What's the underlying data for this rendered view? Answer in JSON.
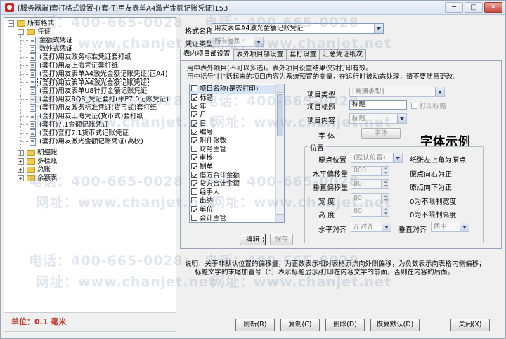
{
  "window": {
    "title": "[服务器端]套打格式设置-[(套打)用友表单A4激光金额记账凭证]153",
    "buttons": [
      "─",
      "□",
      "✕"
    ]
  },
  "tree": {
    "root": "所有格式",
    "voucher_group": "凭证",
    "items": [
      "金额式凭证",
      "数外式凭证",
      "(套打)用友政务标准凭证套打纸",
      "(套打)用友上海凭证套打纸",
      "(套打)用友表单A4激光金额记账凭证(正A4)",
      "(套打)用友表单A4激光金额记账凭证",
      "(套打)用友表单U8针打金额记账凭证",
      "(套打)用友BQ8_凭证套打(平P7.0记账凭证)",
      "(套打)用友政务标准凭证(货币式)套打纸",
      "(套打)用友上海凭证(货币式)套打纸",
      "(套打)7.1金额记账凭证",
      "(套打)套打7.1货币式记账凭证",
      "(套打)用友激光金额记账凭证(高校)"
    ],
    "selected_index": 5,
    "other_groups": [
      "明细账",
      "多栏账",
      "总账",
      "余额表"
    ]
  },
  "unit": "单位：0.1 毫米",
  "form": {
    "format_name_label": "格式名称",
    "format_name_value": "用友表单A4激光金额记账凭证",
    "voucher_type_label": "凭证类型",
    "voucher_type_value": "所有类型"
  },
  "tabs": [
    "表内项目部设置",
    "表外项目部设置",
    "套打设置",
    "汇总凭证纸次"
  ],
  "active_tab": 0,
  "notes": {
    "line1": "用中表外项目(不可以多选)。表外项目设置结果仅对打印有效。",
    "line2": "用中括号“[]”括起来的项目内容为系统预置的变量，在运行时被动态处理，请不要随意更改。"
  },
  "checklist": {
    "header": "项目名称(是否打印)",
    "items": [
      {
        "label": "标题",
        "checked": true
      },
      {
        "label": "年",
        "checked": true
      },
      {
        "label": "月",
        "checked": true
      },
      {
        "label": "日",
        "checked": true
      },
      {
        "label": "编号",
        "checked": true
      },
      {
        "label": "附件张数",
        "checked": true
      },
      {
        "label": "财务主管",
        "checked": false
      },
      {
        "label": "审核",
        "checked": true
      },
      {
        "label": "制单",
        "checked": true
      },
      {
        "label": "借方合计金额",
        "checked": true
      },
      {
        "label": "贷方合计金额",
        "checked": true
      },
      {
        "label": "经手人",
        "checked": false
      },
      {
        "label": "出纳",
        "checked": false
      },
      {
        "label": "单位",
        "checked": true
      },
      {
        "label": "会计主管",
        "checked": false
      }
    ]
  },
  "list_buttons": {
    "edit": "编辑",
    "save": "保存"
  },
  "props": {
    "item_type_label": "项目类型",
    "item_type_value": "[普通类型]",
    "item_title_label": "项目标题",
    "item_title_value": "标题",
    "print_title_label": "打印标题",
    "item_content_label": "项目内容",
    "item_content_value": "标题",
    "font_label": "字    体",
    "font_button": "字体",
    "sample": "字体示例"
  },
  "position": {
    "group_title": "位置",
    "origin_label": "原点位置",
    "origin_value": "(默认位置)",
    "origin_note": "纸张左上角为原点",
    "h_offset_label": "水平偏移量",
    "h_offset_value": "800",
    "h_offset_note": "原点向右为正",
    "v_offset_label": "垂直偏移量",
    "v_offset_value": "80",
    "v_offset_note": "原点向下为正",
    "width_label": "宽    度",
    "width_value": "80",
    "width_note": "0为不限制宽度",
    "height_label": "高    度",
    "height_value": "80",
    "height_note": "0为不限制高度",
    "halign_label": "水平对齐",
    "halign_value": "左对齐",
    "valign_label": "垂直对齐",
    "valign_value": "居中"
  },
  "description": {
    "line1": "说明：关于非默认位置的偏移量，为正数表示相对表格原点向外侧偏移，为负数表示向表格内侧偏移；",
    "line2": "标题文字的末尾加冒号（：）表示标题显示/打印在内容文字的前面，否则在内容的后面。"
  },
  "bottom_buttons": [
    "刷新(R)",
    "复制(C)",
    "删除(D)",
    "恢复默认(D)",
    "关闭(X)"
  ],
  "watermarks": {
    "phone": "电话：400-665-0028",
    "site": "网址：www.chanjet.net"
  }
}
